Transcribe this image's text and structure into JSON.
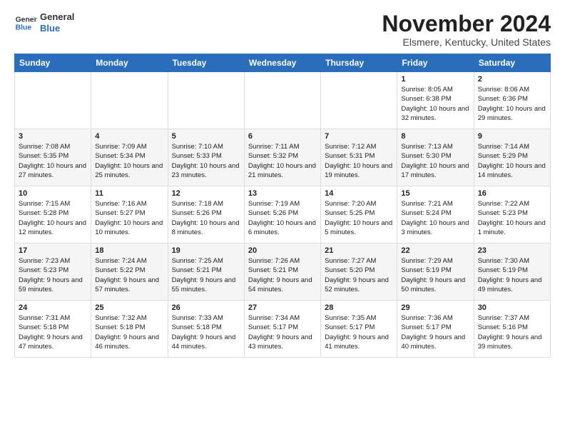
{
  "header": {
    "logo_line1": "General",
    "logo_line2": "Blue",
    "month": "November 2024",
    "location": "Elsmere, Kentucky, United States"
  },
  "weekdays": [
    "Sunday",
    "Monday",
    "Tuesday",
    "Wednesday",
    "Thursday",
    "Friday",
    "Saturday"
  ],
  "weeks": [
    [
      {
        "day": "",
        "info": ""
      },
      {
        "day": "",
        "info": ""
      },
      {
        "day": "",
        "info": ""
      },
      {
        "day": "",
        "info": ""
      },
      {
        "day": "",
        "info": ""
      },
      {
        "day": "1",
        "info": "Sunrise: 8:05 AM\nSunset: 6:38 PM\nDaylight: 10 hours and 32 minutes."
      },
      {
        "day": "2",
        "info": "Sunrise: 8:06 AM\nSunset: 6:36 PM\nDaylight: 10 hours and 29 minutes."
      }
    ],
    [
      {
        "day": "3",
        "info": "Sunrise: 7:08 AM\nSunset: 5:35 PM\nDaylight: 10 hours and 27 minutes."
      },
      {
        "day": "4",
        "info": "Sunrise: 7:09 AM\nSunset: 5:34 PM\nDaylight: 10 hours and 25 minutes."
      },
      {
        "day": "5",
        "info": "Sunrise: 7:10 AM\nSunset: 5:33 PM\nDaylight: 10 hours and 23 minutes."
      },
      {
        "day": "6",
        "info": "Sunrise: 7:11 AM\nSunset: 5:32 PM\nDaylight: 10 hours and 21 minutes."
      },
      {
        "day": "7",
        "info": "Sunrise: 7:12 AM\nSunset: 5:31 PM\nDaylight: 10 hours and 19 minutes."
      },
      {
        "day": "8",
        "info": "Sunrise: 7:13 AM\nSunset: 5:30 PM\nDaylight: 10 hours and 17 minutes."
      },
      {
        "day": "9",
        "info": "Sunrise: 7:14 AM\nSunset: 5:29 PM\nDaylight: 10 hours and 14 minutes."
      }
    ],
    [
      {
        "day": "10",
        "info": "Sunrise: 7:15 AM\nSunset: 5:28 PM\nDaylight: 10 hours and 12 minutes."
      },
      {
        "day": "11",
        "info": "Sunrise: 7:16 AM\nSunset: 5:27 PM\nDaylight: 10 hours and 10 minutes."
      },
      {
        "day": "12",
        "info": "Sunrise: 7:18 AM\nSunset: 5:26 PM\nDaylight: 10 hours and 8 minutes."
      },
      {
        "day": "13",
        "info": "Sunrise: 7:19 AM\nSunset: 5:26 PM\nDaylight: 10 hours and 6 minutes."
      },
      {
        "day": "14",
        "info": "Sunrise: 7:20 AM\nSunset: 5:25 PM\nDaylight: 10 hours and 5 minutes."
      },
      {
        "day": "15",
        "info": "Sunrise: 7:21 AM\nSunset: 5:24 PM\nDaylight: 10 hours and 3 minutes."
      },
      {
        "day": "16",
        "info": "Sunrise: 7:22 AM\nSunset: 5:23 PM\nDaylight: 10 hours and 1 minute."
      }
    ],
    [
      {
        "day": "17",
        "info": "Sunrise: 7:23 AM\nSunset: 5:23 PM\nDaylight: 9 hours and 59 minutes."
      },
      {
        "day": "18",
        "info": "Sunrise: 7:24 AM\nSunset: 5:22 PM\nDaylight: 9 hours and 57 minutes."
      },
      {
        "day": "19",
        "info": "Sunrise: 7:25 AM\nSunset: 5:21 PM\nDaylight: 9 hours and 55 minutes."
      },
      {
        "day": "20",
        "info": "Sunrise: 7:26 AM\nSunset: 5:21 PM\nDaylight: 9 hours and 54 minutes."
      },
      {
        "day": "21",
        "info": "Sunrise: 7:27 AM\nSunset: 5:20 PM\nDaylight: 9 hours and 52 minutes."
      },
      {
        "day": "22",
        "info": "Sunrise: 7:29 AM\nSunset: 5:19 PM\nDaylight: 9 hours and 50 minutes."
      },
      {
        "day": "23",
        "info": "Sunrise: 7:30 AM\nSunset: 5:19 PM\nDaylight: 9 hours and 49 minutes."
      }
    ],
    [
      {
        "day": "24",
        "info": "Sunrise: 7:31 AM\nSunset: 5:18 PM\nDaylight: 9 hours and 47 minutes."
      },
      {
        "day": "25",
        "info": "Sunrise: 7:32 AM\nSunset: 5:18 PM\nDaylight: 9 hours and 46 minutes."
      },
      {
        "day": "26",
        "info": "Sunrise: 7:33 AM\nSunset: 5:18 PM\nDaylight: 9 hours and 44 minutes."
      },
      {
        "day": "27",
        "info": "Sunrise: 7:34 AM\nSunset: 5:17 PM\nDaylight: 9 hours and 43 minutes."
      },
      {
        "day": "28",
        "info": "Sunrise: 7:35 AM\nSunset: 5:17 PM\nDaylight: 9 hours and 41 minutes."
      },
      {
        "day": "29",
        "info": "Sunrise: 7:36 AM\nSunset: 5:17 PM\nDaylight: 9 hours and 40 minutes."
      },
      {
        "day": "30",
        "info": "Sunrise: 7:37 AM\nSunset: 5:16 PM\nDaylight: 9 hours and 39 minutes."
      }
    ]
  ]
}
